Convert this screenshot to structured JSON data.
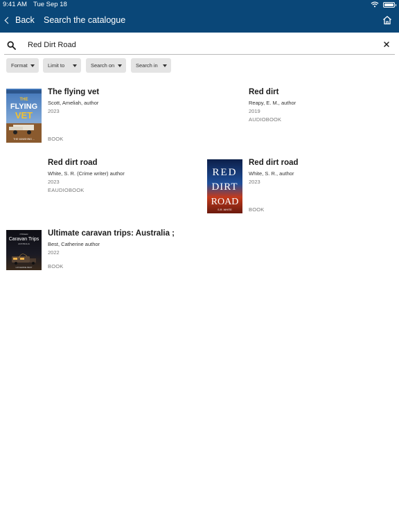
{
  "status_bar": {
    "time": "9:41 AM",
    "date": "Tue Sep 18"
  },
  "nav": {
    "back_label": "Back",
    "title": "Search the catalogue"
  },
  "search": {
    "query": "Red Dirt Road"
  },
  "filters": [
    {
      "label": "Format"
    },
    {
      "label": "Limit to"
    },
    {
      "label": "Search on"
    },
    {
      "label": "Search in"
    }
  ],
  "results": [
    {
      "title": "The flying vet",
      "author": "Scott, Ameliah, author",
      "year": "2023",
      "format": "BOOK",
      "cover": {
        "top_text": "THE",
        "main_text": "FLYING",
        "accent_text": "VET",
        "bottom_text": "THE VANISHING ...",
        "colors": {
          "sky": "#4b7fc0",
          "accent": "#f2c12e"
        }
      }
    },
    {
      "title": "Red dirt",
      "author": "Reapy, E. M., author",
      "year": "2019",
      "format": "AUDIOBOOK"
    },
    {
      "title": "Red dirt road",
      "author": "White, S. R. (Crime writer) author",
      "year": "2023",
      "format": "EAUDIOBOOK"
    },
    {
      "title": "Red dirt road",
      "author": "White, S. R., author",
      "year": "2023",
      "format": "BOOK",
      "cover": {
        "line1": "RED",
        "line2": "DIRT",
        "line3": "ROAD",
        "byline": "S.R. WHITE"
      }
    },
    {
      "title": "Ultimate caravan trips: Australia ;",
      "author": "Best, Catherine author",
      "year": "2022",
      "format": "BOOK",
      "cover": {
        "kicker": "Ultimate",
        "main_text": "Caravan Trips",
        "sub_text": "AUSTRALIA",
        "bottom_text": "CATHERINE BEST"
      }
    }
  ]
}
